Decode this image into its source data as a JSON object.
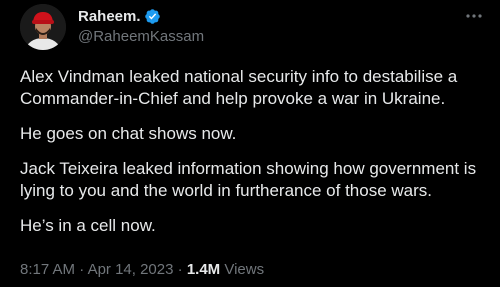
{
  "author": {
    "display_name": "Raheem.",
    "handle": "@RaheemKassam",
    "verified": true,
    "avatar_icon": "profile-photo-red-cap"
  },
  "tweet": {
    "paragraphs": [
      "Alex Vindman leaked national security info to destabilise a Commander-in-Chief and help provoke a war in Ukraine.",
      "He goes on chat shows now.",
      "Jack Teixeira leaked information showing how government is lying to you and the world in furtherance of those wars.",
      "He’s in a cell now."
    ]
  },
  "meta": {
    "time": "8:17 AM",
    "separator": "·",
    "date": "Apr 14, 2023",
    "views_count": "1.4M",
    "views_label": "Views"
  },
  "colors": {
    "background": "#000000",
    "text_primary": "#e7e9ea",
    "text_secondary": "#71767b",
    "verified_blue": "#1d9bf0"
  },
  "icons": {
    "more": "more-horizontal-icon",
    "verified": "verified-badge-icon"
  }
}
